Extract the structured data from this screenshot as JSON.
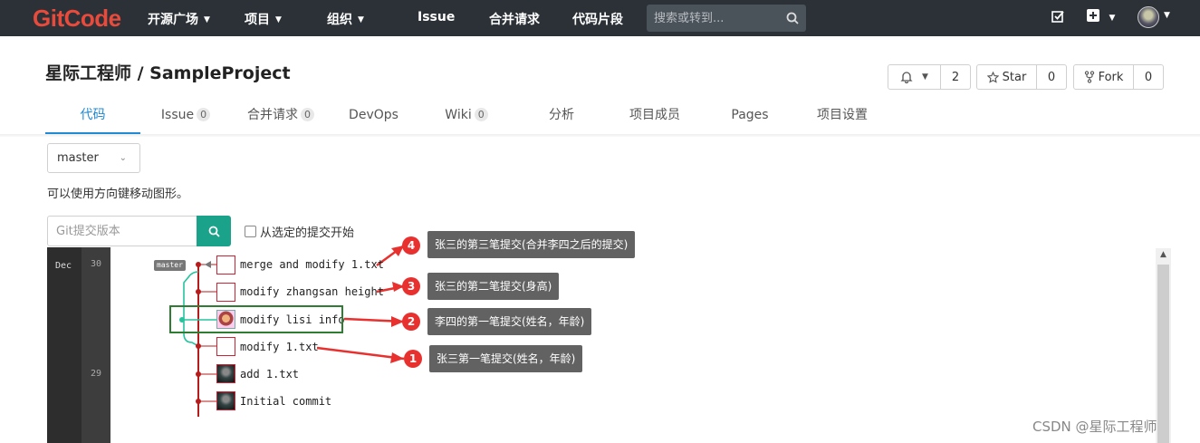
{
  "topbar": {
    "logo": "GitCode",
    "nav": [
      {
        "label": "开源广场",
        "dropdown": true
      },
      {
        "label": "项目",
        "dropdown": true
      },
      {
        "label": "组织",
        "dropdown": true
      },
      {
        "label": "Issue",
        "dropdown": false
      },
      {
        "label": "合并请求",
        "dropdown": false
      },
      {
        "label": "代码片段",
        "dropdown": false
      }
    ],
    "search_placeholder": "搜索或转到...",
    "colors": {
      "bar": "#2b3137",
      "logo": "#e84b3c"
    }
  },
  "project": {
    "title": "星际工程师 / SampleProject",
    "notify_count": "2",
    "star_label": "Star",
    "star_count": "0",
    "fork_label": "Fork",
    "fork_count": "0"
  },
  "tabs": [
    {
      "label": "代码",
      "active": true
    },
    {
      "label": "Issue",
      "badge": "0"
    },
    {
      "label": "合并请求",
      "badge": "0"
    },
    {
      "label": "DevOps"
    },
    {
      "label": "Wiki",
      "badge": "0"
    },
    {
      "label": "分析"
    },
    {
      "label": "项目成员"
    },
    {
      "label": "Pages"
    },
    {
      "label": "项目设置"
    }
  ],
  "branch": {
    "selected": "master"
  },
  "hint": "可以使用方向键移动图形。",
  "sha_search": {
    "placeholder": "Git提交版本",
    "checkbox_label": "从选定的提交开始"
  },
  "graph": {
    "month": "Dec",
    "days": [
      "30",
      "29"
    ],
    "branch_tag": "master",
    "commits": [
      {
        "message": "merge and modify 1.txt"
      },
      {
        "message": "modify zhangsan height"
      },
      {
        "message": "modify lisi info"
      },
      {
        "message": "modify 1.txt"
      },
      {
        "message": "add 1.txt"
      },
      {
        "message": "Initial commit"
      }
    ]
  },
  "annotations": [
    {
      "num": "4",
      "text": "张三的第三笔提交(合并李四之后的提交)"
    },
    {
      "num": "3",
      "text": "张三的第二笔提交(身高)"
    },
    {
      "num": "2",
      "text": "李四的第一笔提交(姓名，年龄)"
    },
    {
      "num": "1",
      "text": "张三第一笔提交(姓名，年龄)"
    }
  ],
  "watermark": "CSDN @星际工程师"
}
